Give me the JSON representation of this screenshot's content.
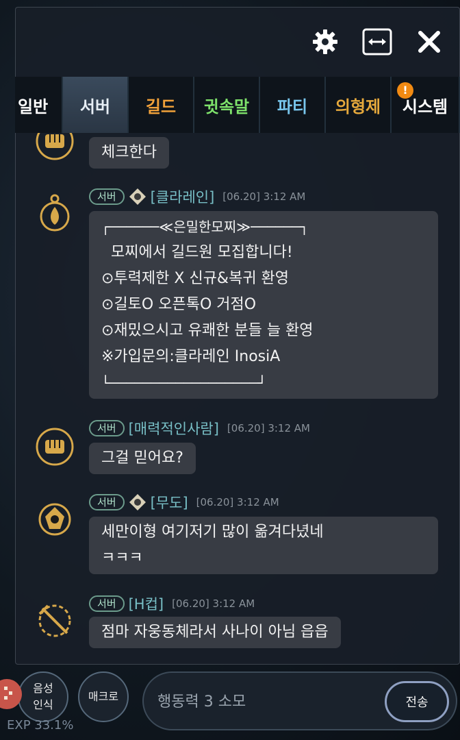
{
  "window": {
    "settings_icon": "gear-icon",
    "resize_icon": "resize-horizontal-icon",
    "close_icon": "close-icon"
  },
  "tabs": [
    {
      "label": "일반",
      "color": "#ffffff",
      "active": false
    },
    {
      "label": "서버",
      "color": "#e7eef5",
      "active": true
    },
    {
      "label": "길드",
      "color": "#f2a23a",
      "active": false
    },
    {
      "label": "귓속말",
      "color": "#7ee26b",
      "active": false
    },
    {
      "label": "파티",
      "color": "#79c7ee",
      "active": false
    },
    {
      "label": "의형제",
      "color": "#e6a93c",
      "active": false
    },
    {
      "label": "시스템",
      "color": "#ffffff",
      "active": false,
      "alert": "!"
    }
  ],
  "messages": [
    {
      "channel": "",
      "name": "",
      "time": "",
      "lines": [
        "체크한다"
      ]
    },
    {
      "channel": "서버",
      "name": "[클라레인]",
      "time": "[06.20] 3:12 AM",
      "lines": [
        "┌──────≪은밀한모찌≫──────┐",
        "  모찌에서 길드원 모집합니다!",
        "⊙투력제한 X 신규&복귀 환영",
        "⊙길토O 오픈톡O 거점O",
        "⊙재밌으시고 유쾌한 분들 늘 환영",
        "※가입문의:클라레인 InosiA",
        "└──────────────────┘"
      ]
    },
    {
      "channel": "서버",
      "name": "[매력적인사람]",
      "time": "[06.20] 3:12 AM",
      "lines": [
        "그걸 믿어요?"
      ]
    },
    {
      "channel": "서버",
      "name": "[무도]",
      "time": "[06.20] 3:12 AM",
      "lines": [
        "세만이형 여기저기 많이 옮겨다녔네",
        "ㅋㅋㅋ"
      ]
    },
    {
      "channel": "서버",
      "name": "[H컵]",
      "time": "[06.20] 3:12 AM",
      "lines": [
        "점마 자웅동체라서 사나이 아님 읍읍"
      ]
    }
  ],
  "bottom": {
    "voice_label_1": "음성",
    "voice_label_2": "인식",
    "macro_label": "매크로",
    "input_placeholder": "행동력 3 소모",
    "send_label": "전송",
    "exp_text": "EXP 33.1%"
  },
  "colors": {
    "accent": "#78bfc6",
    "alert": "#f18a12",
    "pill": "#6c9c8c"
  }
}
